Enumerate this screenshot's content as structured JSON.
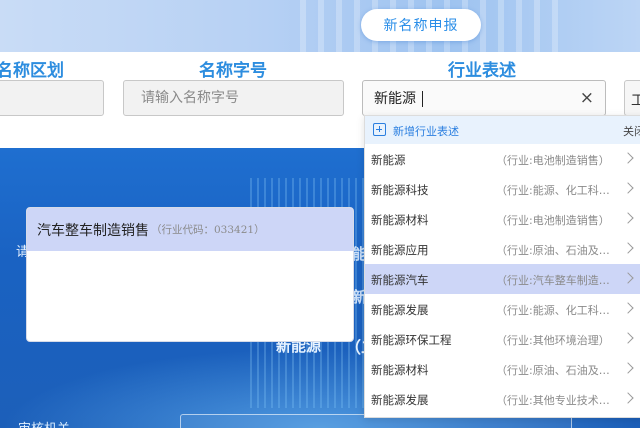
{
  "banner": {
    "button_label": "新名称申报"
  },
  "form": {
    "region_label": "名称区划",
    "name_label": "名称字号",
    "name_placeholder": "请输入名称字号",
    "industry_label": "行业表述",
    "industry_value": "新能源",
    "clear_icon": "×",
    "right_box_text": "工"
  },
  "selected_card": {
    "name": "汽车整车制造销售",
    "code_text": "（行业代码：033421）"
  },
  "dropdown": {
    "add_label": "新增行业表述",
    "close_label": "关闭",
    "items": [
      {
        "name": "新能源",
        "category": "（行业:电池制造销售）"
      },
      {
        "name": "新能源科技",
        "category": "（行业:能源、化工科…"
      },
      {
        "name": "新能源材料",
        "category": "（行业:电池制造销售）"
      },
      {
        "name": "新能源应用",
        "category": "（行业:原油、石油及…"
      },
      {
        "name": "新能源汽车",
        "category": "（行业:汽车整车制造…",
        "active": true
      },
      {
        "name": "新能源发展",
        "category": "（行业:能源、化工科…"
      },
      {
        "name": "新能源环保工程",
        "category": "（行业:其他环境治理）"
      },
      {
        "name": "新能源材料",
        "category": "（行业:原油、石油及…"
      },
      {
        "name": "新能源发展",
        "category": "（行业:其他专业技术…"
      }
    ]
  },
  "background": {
    "new_energy_text": "新能源",
    "paren_text": "（二",
    "left_text": "请",
    "bottom_left_text": "审核机关",
    "glyph_a": "能",
    "glyph_b": "新"
  },
  "colors": {
    "accent": "#2d8ddf",
    "active_row": "#cdd6f7",
    "link": "#2b7fe0"
  }
}
